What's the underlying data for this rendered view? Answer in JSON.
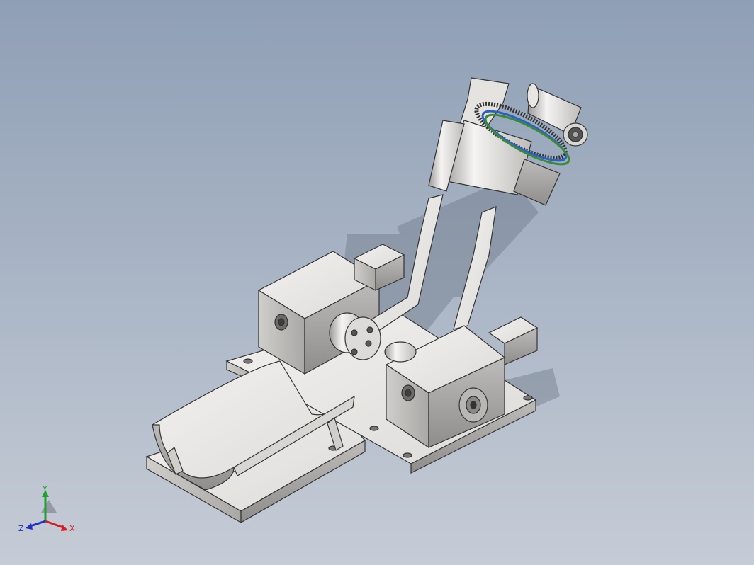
{
  "viewport": {
    "background_top": "#8f9fb5",
    "background_bottom": "#c6ccd6"
  },
  "model": {
    "part_color": "#e9e8e6",
    "shadow_color": "#6f7a8a",
    "gear_color": "#3a6b3a",
    "blue_ring_color": "#2e5fc4"
  },
  "triad": {
    "x_label": "X",
    "y_label": "Y",
    "z_label": "Z",
    "x_color": "#d02020",
    "y_color": "#20a030",
    "z_color": "#2030c0"
  }
}
